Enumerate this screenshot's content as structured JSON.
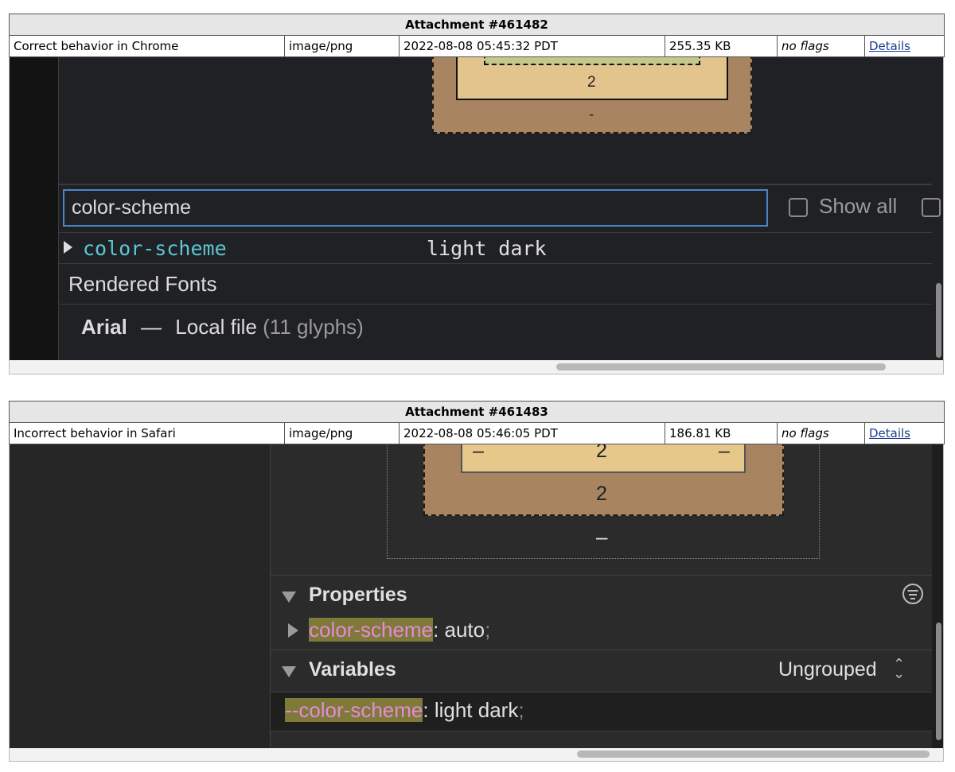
{
  "attachments": [
    {
      "header": "Attachment #461482",
      "description": "Correct behavior in Chrome",
      "type": "image/png",
      "date": "2022-08-08 05:45:32 PDT",
      "size": "255.35 KB",
      "flags": "no flags",
      "details_link": "Details",
      "screenshot": {
        "box_model": {
          "border_value": "2",
          "margin_value": "-"
        },
        "filter": {
          "value": "color-scheme",
          "show_all_label": "Show all"
        },
        "property": {
          "name": "color-scheme",
          "value": "light dark"
        },
        "rendered_fonts": {
          "title": "Rendered Fonts",
          "font_name": "Arial",
          "dash": "—",
          "source": "Local file",
          "glyphs": "(11 glyphs)"
        }
      }
    },
    {
      "header": "Attachment #461483",
      "description": "Incorrect behavior in Safari",
      "type": "image/png",
      "date": "2022-08-08 05:46:05 PDT",
      "size": "186.81 KB",
      "flags": "no flags",
      "details_link": "Details",
      "screenshot": {
        "box_model": {
          "top_value": "2",
          "side_left": "–",
          "side_right": "–",
          "border_value": "2",
          "outer_value": "–"
        },
        "properties": {
          "title": "Properties",
          "name": "color-scheme",
          "value": "auto",
          "semicolon": ";"
        },
        "variables": {
          "title": "Variables",
          "grouping": "Ungrouped",
          "name": "--color-scheme",
          "value": "light dark",
          "semicolon": ";"
        }
      }
    }
  ],
  "icons": {
    "disclosure": "disclosure-triangle-icon",
    "filter": "filter-lines-icon",
    "updown": "up-down-chevron-icon"
  }
}
